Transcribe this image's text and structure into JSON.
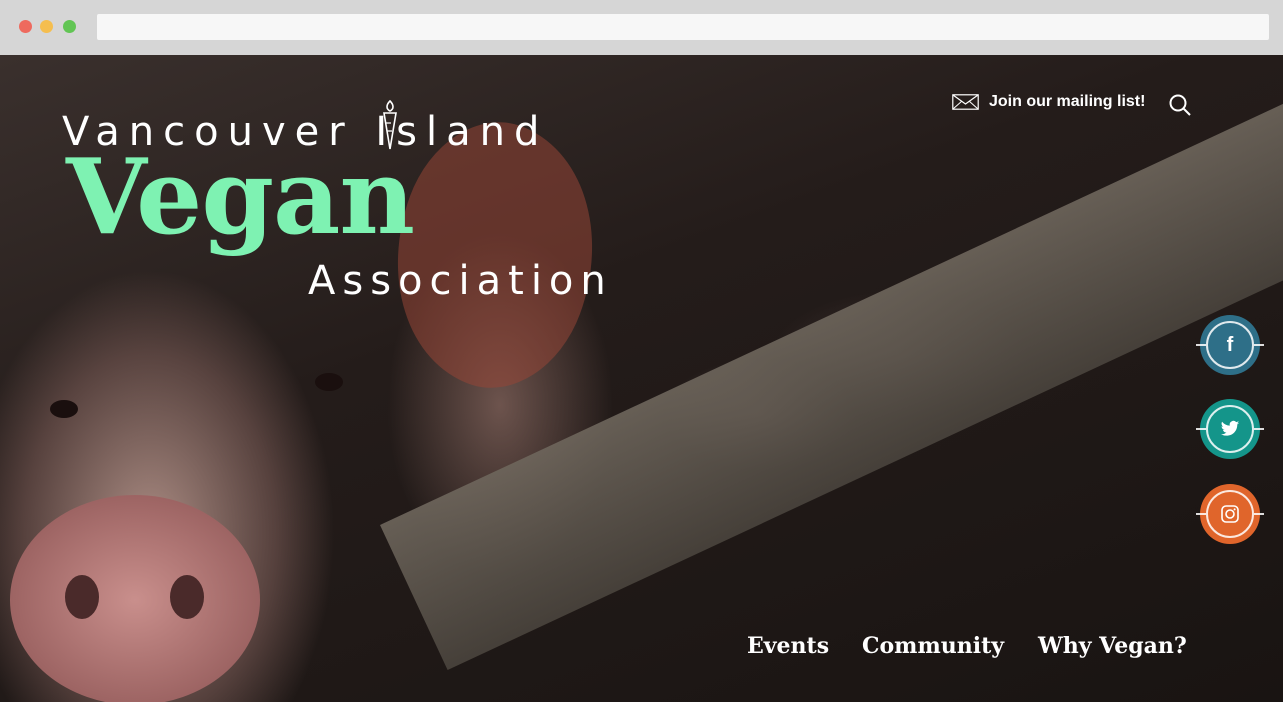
{
  "site": {
    "logo": {
      "line1": "Vancouver Island",
      "line2": "Vegan",
      "line3": "Association",
      "accent_color": "#7ef2b2"
    },
    "header": {
      "mailing_label": "Join our mailing list!",
      "mail_icon": "envelope-icon",
      "search_icon": "search-icon"
    },
    "social": [
      {
        "name": "facebook",
        "glyph": "f",
        "color": "#2e6f88"
      },
      {
        "name": "twitter",
        "glyph": "🐦",
        "color": "#14958a"
      },
      {
        "name": "instagram",
        "glyph": "◎",
        "color": "#e0652b"
      }
    ],
    "nav": {
      "events": "Events",
      "community": "Community",
      "why_vegan": "Why Vegan?"
    }
  }
}
